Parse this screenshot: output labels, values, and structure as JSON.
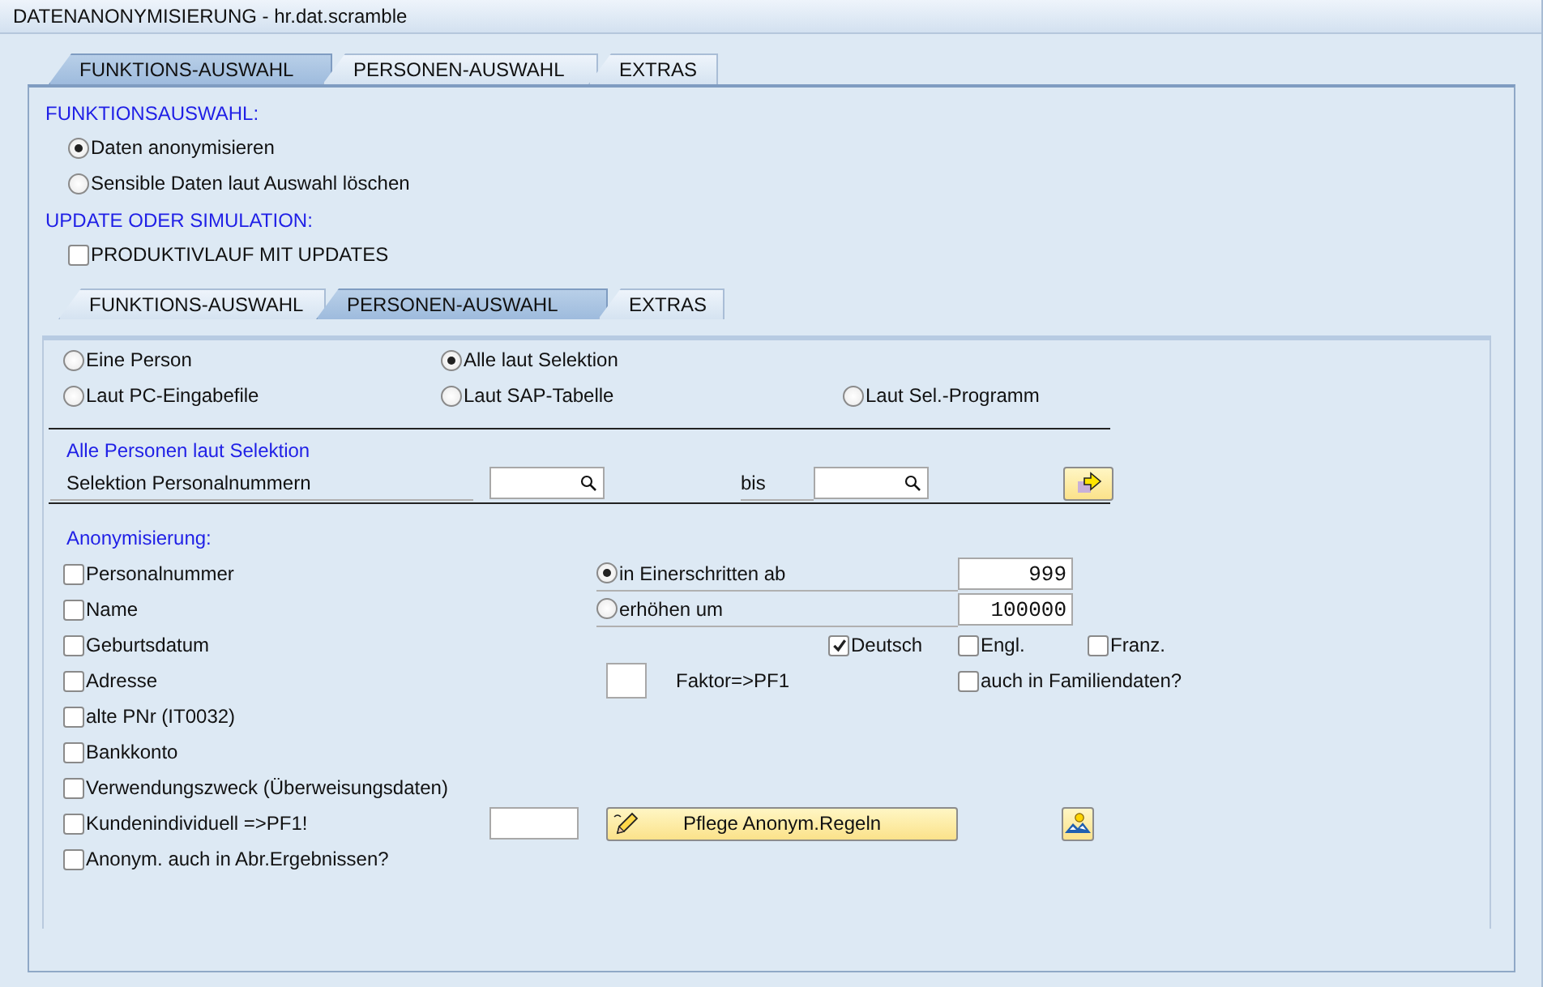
{
  "window": {
    "title": "DATENANONYMISIERUNG - hr.dat.scramble"
  },
  "outer_tabs": [
    {
      "label": "FUNKTIONS-AUSWAHL",
      "selected": true
    },
    {
      "label": "PERSONEN-AUSWAHL",
      "selected": false
    },
    {
      "label": "EXTRAS",
      "selected": false
    }
  ],
  "funktionsauswahl": {
    "heading": "FUNKTIONSAUSWAHL:",
    "options": [
      {
        "label": "Daten anonymisieren",
        "selected": true
      },
      {
        "label": "Sensible Daten laut Auswahl löschen",
        "selected": false
      }
    ]
  },
  "update": {
    "heading": "UPDATE ODER SIMULATION:",
    "checkbox": {
      "label": "PRODUKTIVLAUF MIT UPDATES",
      "checked": false
    }
  },
  "inner_tabs": [
    {
      "label": "FUNKTIONS-AUSWAHL",
      "selected": false
    },
    {
      "label": "PERSONEN-AUSWAHL",
      "selected": true
    },
    {
      "label": "EXTRAS",
      "selected": false
    }
  ],
  "person_options": [
    {
      "label": "Eine Person",
      "selected": false
    },
    {
      "label": "Alle laut Selektion",
      "selected": true
    },
    {
      "label": "Laut PC-Eingabefile",
      "selected": false
    },
    {
      "label": "Laut SAP-Tabelle",
      "selected": false
    },
    {
      "label": "Laut Sel.-Programm",
      "selected": false
    }
  ],
  "selection": {
    "heading": "Alle Personen laut Selektion",
    "label": "Selektion Personalnummern",
    "to_label": "bis"
  },
  "anonymisierung": {
    "heading": "Anonymisierung:",
    "items": [
      {
        "label": "Personalnummer",
        "checked": false
      },
      {
        "label": "Name",
        "checked": false
      },
      {
        "label": "Geburtsdatum",
        "checked": false
      },
      {
        "label": "Adresse",
        "checked": false
      },
      {
        "label": "alte PNr (IT0032)",
        "checked": false
      },
      {
        "label": "Bankkonto",
        "checked": false
      },
      {
        "label": "Verwendungszweck (Überweisungsdaten)",
        "checked": false
      },
      {
        "label": "Kundenindividuell =>PF1!",
        "checked": false
      },
      {
        "label": "Anonym. auch in Abr.Ergebnissen?",
        "checked": false
      }
    ],
    "numbering": [
      {
        "label": "in Einerschritten ab",
        "selected": true,
        "value": "999"
      },
      {
        "label": "erhöhen um",
        "selected": false,
        "value": "100000"
      }
    ],
    "languages": [
      {
        "label": "Deutsch",
        "checked": true
      },
      {
        "label": "Engl.",
        "checked": false
      },
      {
        "label": "Franz.",
        "checked": false
      }
    ],
    "factor_label": "Faktor=>PF1",
    "family": {
      "label": "auch in Familiendaten?",
      "checked": false
    },
    "rules_button": "Pflege Anonym.Regeln"
  }
}
